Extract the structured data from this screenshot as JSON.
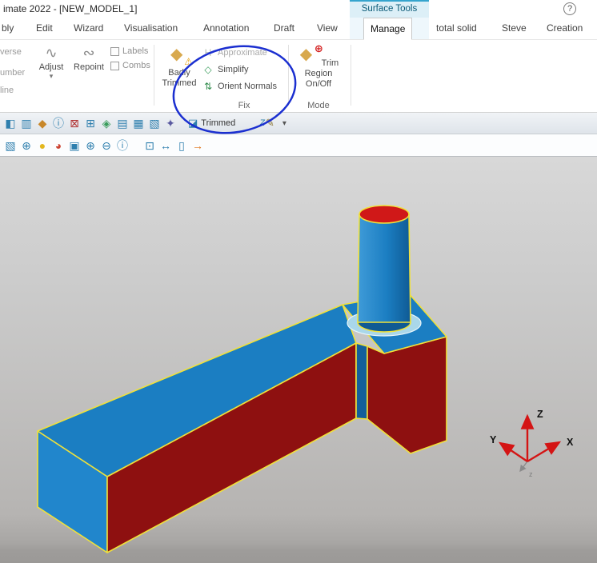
{
  "window": {
    "title": "imate 2022 - [NEW_MODEL_1]",
    "contextual_group": "Surface Tools",
    "help_label": "?"
  },
  "tabs": [
    "bly",
    "Edit",
    "Wizard",
    "Visualisation",
    "Annotation",
    "Draft",
    "View",
    "Manage",
    "total solid",
    "Steve",
    "Creation"
  ],
  "active_tab": "Manage",
  "ribbon": {
    "clipped": [
      "verse",
      "umber",
      "line"
    ],
    "adjust_label": "Adjust",
    "adjust_caret": "▾",
    "repoint_label": "Repoint",
    "labels_checkbox": "Labels",
    "combs_checkbox": "Combs",
    "badly_trimmed": {
      "line1": "Badly",
      "line2": "Trimmed",
      "icon_glyph": "◆",
      "warn_glyph": "⚠"
    },
    "fix_items": [
      {
        "label": "Approximate",
        "glyph": "H",
        "color": "#9fae9f",
        "disabled": true
      },
      {
        "label": "Simplify",
        "glyph": "◇",
        "color": "#3a9d5c",
        "disabled": false
      },
      {
        "label": "Orient Normals",
        "glyph": "⇅",
        "color": "#2e8b4a",
        "disabled": false
      }
    ],
    "fix_group_label": "Fix",
    "trim_region": {
      "line1": "Trim Region",
      "line2": "On/Off",
      "icon_glyph": "◆",
      "plus_glyph": "⊕"
    },
    "mode_group_label": "Mode",
    "adjust_icon_glyph": "∿",
    "repoint_icon_glyph": "∾"
  },
  "toolbar1": {
    "icons": [
      {
        "name": "curve-edit-icon",
        "glyph": "◧",
        "color": "#2e7fae"
      },
      {
        "name": "surface-grid-icon",
        "glyph": "▥",
        "color": "#2e7fae"
      },
      {
        "name": "patch-icon",
        "glyph": "◆",
        "color": "#c8872a"
      },
      {
        "name": "info-icon",
        "glyph": "ⓘ",
        "color": "#2e7fae"
      },
      {
        "name": "delete-grid-icon",
        "glyph": "⊠",
        "color": "#b03030"
      },
      {
        "name": "add-surface-icon",
        "glyph": "⊞",
        "color": "#2e7fae"
      },
      {
        "name": "diamond-icon",
        "glyph": "◈",
        "color": "#3a9d5c"
      },
      {
        "name": "copy-sheet-icon",
        "glyph": "▤",
        "color": "#2e7fae"
      },
      {
        "name": "paste-sheet-icon",
        "glyph": "▦",
        "color": "#2e7fae"
      },
      {
        "name": "sheet-icon",
        "glyph": "▧",
        "color": "#2e7fae"
      },
      {
        "name": "star-icon",
        "glyph": "✦",
        "color": "#5a5aa0"
      }
    ],
    "trimmed_icon": "◪",
    "trimmed_label": "Trimmed",
    "pencil_z": "Z",
    "pencil_glyph": "✎",
    "caret_glyph": "▾"
  },
  "toolbar2": {
    "icons": [
      {
        "name": "select-surface-icon",
        "glyph": "▧",
        "color": "#2e7fae"
      },
      {
        "name": "globe-icon",
        "glyph": "⊕",
        "color": "#2e7fae"
      },
      {
        "name": "sphere-yellow-icon",
        "glyph": "●",
        "color": "#e3b71e"
      },
      {
        "name": "sphere-shaded-icon",
        "glyph": "◕",
        "color": "#cc4433"
      },
      {
        "name": "view-box-icon",
        "glyph": "▣",
        "color": "#2e7fae"
      },
      {
        "name": "zoom-in-icon",
        "glyph": "⊕",
        "color": "#2e7fae"
      },
      {
        "name": "zoom-out-icon",
        "glyph": "⊖",
        "color": "#2e7fae"
      },
      {
        "name": "info-icon",
        "glyph": "ⓘ",
        "color": "#2e7fae"
      },
      {
        "name": "zoom-page-icon",
        "glyph": "⊡",
        "color": "#2e7fae",
        "gap": true
      },
      {
        "name": "ruler-icon",
        "glyph": "↔",
        "color": "#2e7fae"
      },
      {
        "name": "page-icon",
        "glyph": "▯",
        "color": "#2e7fae"
      },
      {
        "name": "export-arrow-icon",
        "glyph": "→",
        "color": "#e07820"
      }
    ]
  },
  "scene": {
    "axis": {
      "x": "X",
      "y": "Y",
      "z": "Z",
      "z_small": "z"
    }
  },
  "colors": {
    "model_blue": "#1b7ec2",
    "model_blue2": "#2186cc",
    "model_blue_dark": "#135f9b",
    "model_red": "#8e1010",
    "model_red_bright": "#d01818",
    "edge_yellow": "#f0e13a",
    "fillet_ring": "#a9d7ea",
    "fillet_ring_edge": "#e8f5fa",
    "cyl_light": "#3f9bd8",
    "cyl_mid": "#1b7ec2",
    "cyl_dark": "#0f5a94",
    "axis_red": "#d41414",
    "axis_gray": "#8a8a8a",
    "annotation_blue": "#1b2fd0"
  }
}
